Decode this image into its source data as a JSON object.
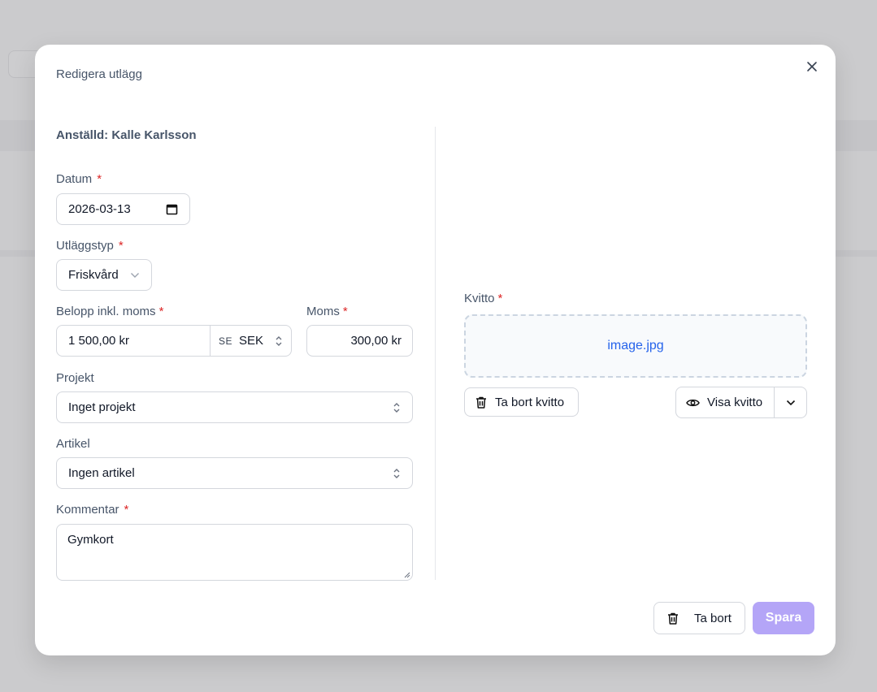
{
  "dialog": {
    "title": "Redigera utlägg",
    "employee": "Anställd: Kalle Karlsson"
  },
  "form": {
    "date": {
      "label": "Datum",
      "value": "2026-03-13"
    },
    "type": {
      "label": "Utläggstyp",
      "value": "Friskvård"
    },
    "amount": {
      "label": "Belopp inkl. moms",
      "value": "1 500,00 kr",
      "currency_flag": "SE",
      "currency": "SEK"
    },
    "vat": {
      "label": "Moms",
      "value": "300,00 kr"
    },
    "project": {
      "label": "Projekt",
      "value": "Inget projekt"
    },
    "article": {
      "label": "Artikel",
      "value": "Ingen artikel"
    },
    "comment": {
      "label": "Kommentar",
      "value": "Gymkort"
    },
    "required_mark": "*"
  },
  "receipt": {
    "label": "Kvitto",
    "file_name": "image.jpg",
    "remove_label": "Ta bort kvitto",
    "view_label": "Visa kvitto"
  },
  "footer": {
    "delete_label": "Ta bort",
    "save_label": "Spara"
  },
  "colors": {
    "primary_disabled": "#b4a5f7",
    "link": "#2563eb",
    "required": "#dc2626"
  }
}
